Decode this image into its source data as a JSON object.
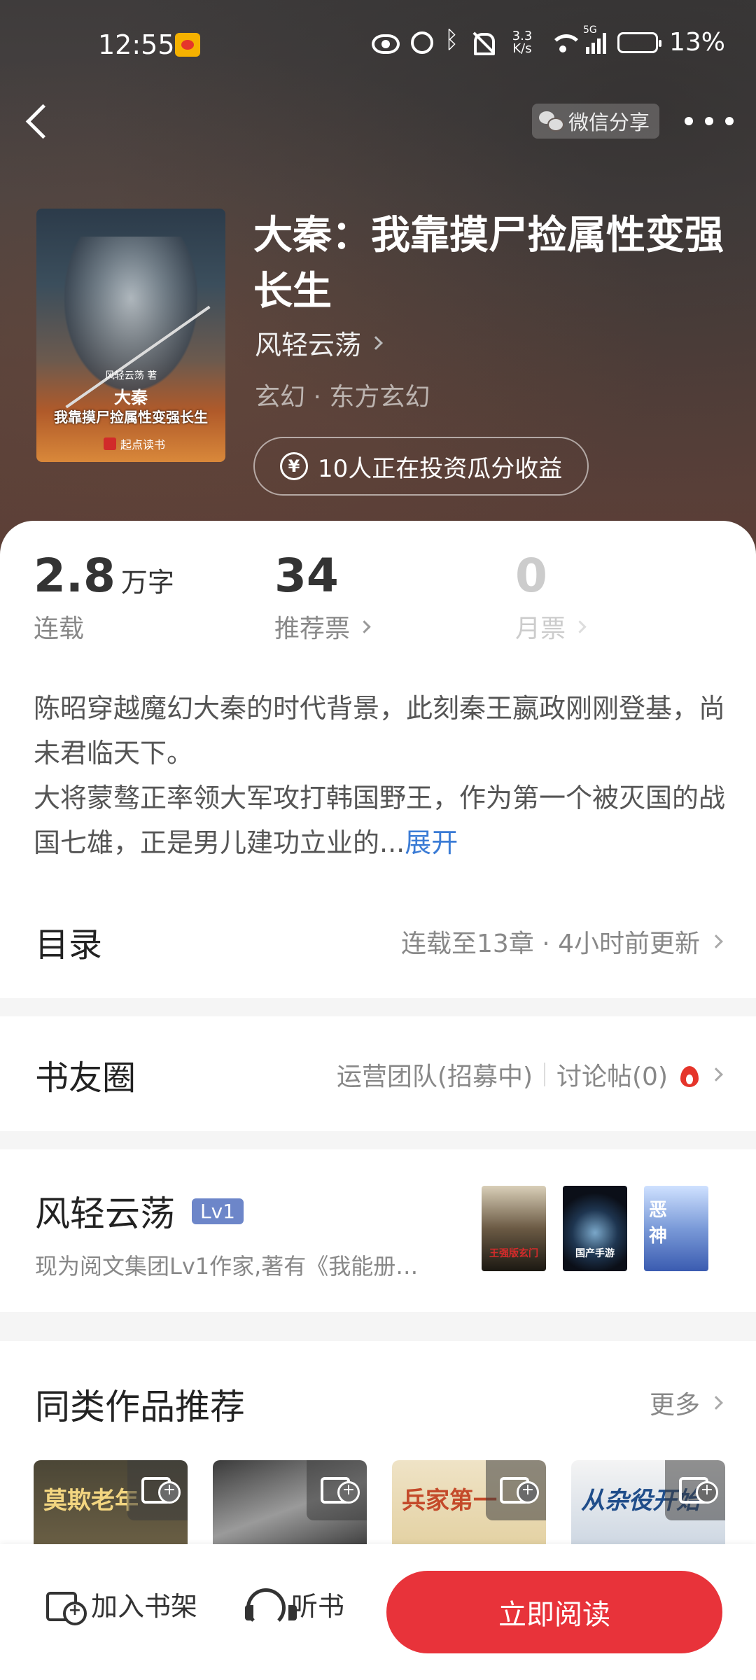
{
  "status_bar": {
    "time": "12:55",
    "net_speed_value": "3.3",
    "net_speed_unit": "K/s",
    "network": "5G",
    "battery_pct": "13%",
    "battery_level": 0.13
  },
  "header": {
    "wechat_share_label": "微信分享"
  },
  "book": {
    "cover_author": "风轻云荡 著",
    "cover_title_line1": "大秦",
    "cover_title_line2": "我靠摸尸捡属性变强长生",
    "cover_publisher": "起点读书",
    "title": "大秦：我靠摸尸捡属性变强长生",
    "author": "风轻云荡",
    "genre": "玄幻 · 东方玄幻",
    "invest_label": "10人正在投资瓜分收益"
  },
  "stats": {
    "words_value": "2.8",
    "words_unit": "万字",
    "words_label": "连载",
    "rec_votes_value": "34",
    "rec_votes_label": "推荐票",
    "monthly_votes_value": "0",
    "monthly_votes_label": "月票"
  },
  "synopsis": {
    "text": "陈昭穿越魔幻大秦的时代背景，此刻秦王嬴政刚刚登基，尚未君临天下。\n大将蒙骜正率领大军攻打韩国野王，作为第一个被灭国的战国七雄，正是男儿建功立业的...",
    "expand_label": "展开"
  },
  "catalog": {
    "title": "目录",
    "meta": "连载至13章 · 4小时前更新"
  },
  "circle": {
    "title": "书友圈",
    "ops_label": "运营团队(招募中)",
    "posts_label": "讨论帖(0)"
  },
  "author_section": {
    "name": "风轻云荡",
    "level": "Lv1",
    "desc": "现为阅文集团Lv1作家,著有《我能册…",
    "books": [
      "王强版玄门",
      "国产手游",
      "恶神"
    ]
  },
  "recommend": {
    "title": "同类作品推荐",
    "more_label": "更多",
    "items": [
      "莫欺老年",
      "",
      "兵家第一",
      "从杂役开始"
    ]
  },
  "bottom_bar": {
    "add_shelf_label": "加入书架",
    "listen_label": "听书",
    "read_label": "立即阅读"
  },
  "colors": {
    "accent_red": "#e8333a",
    "link_blue": "#3a7bd5",
    "level_badge": "#6d86c9"
  }
}
